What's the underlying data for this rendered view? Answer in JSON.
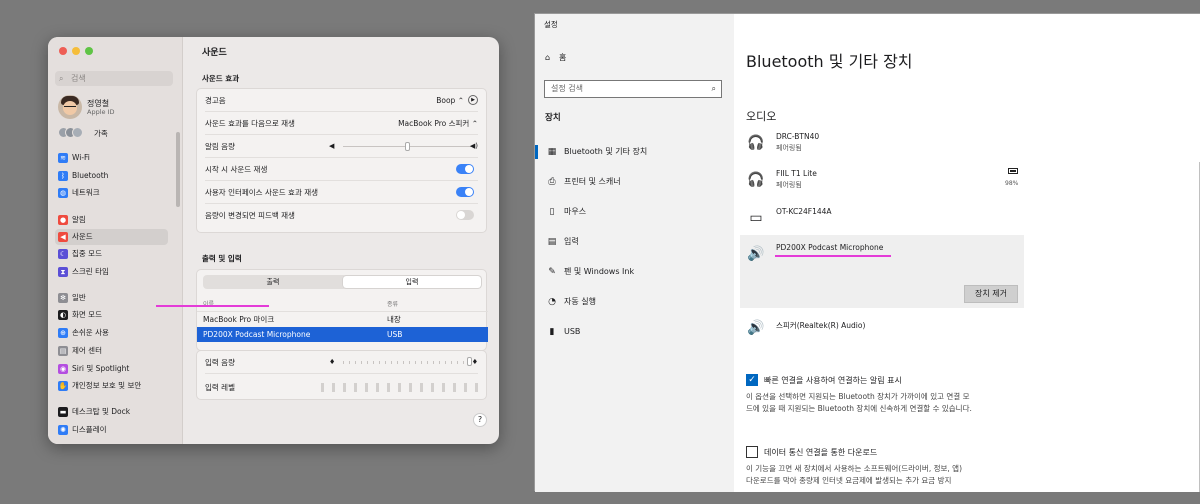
{
  "mac": {
    "search_placeholder": "검색",
    "user": {
      "name": "정영철",
      "sub": "Apple ID"
    },
    "family": "가족",
    "sidebar": [
      {
        "label": "Wi-Fi",
        "icon": "wifi-icon",
        "color": "#2f7cf6"
      },
      {
        "label": "Bluetooth",
        "icon": "bluetooth-icon",
        "color": "#2f7cf6"
      },
      {
        "label": "네트워크",
        "icon": "globe-icon",
        "color": "#2f7cf6"
      },
      {
        "label": "알림",
        "icon": "bell-icon",
        "color": "#ef4b3f"
      },
      {
        "label": "사운드",
        "icon": "speaker-icon",
        "color": "#ef4b3f"
      },
      {
        "label": "집중 모드",
        "icon": "moon-icon",
        "color": "#5b4fd6"
      },
      {
        "label": "스크린 타임",
        "icon": "hourglass-icon",
        "color": "#5b4fd6"
      },
      {
        "label": "일반",
        "icon": "gear-icon",
        "color": "#8e8e93"
      },
      {
        "label": "화면 모드",
        "icon": "appearance-icon",
        "color": "#1c1c1e"
      },
      {
        "label": "손쉬운 사용",
        "icon": "accessibility-icon",
        "color": "#2f7cf6"
      },
      {
        "label": "제어 센터",
        "icon": "control-center-icon",
        "color": "#8e8e93"
      },
      {
        "label": "Siri 및 Spotlight",
        "icon": "siri-icon",
        "color": "#b44ee0"
      },
      {
        "label": "개인정보 보호 및 보안",
        "icon": "hand-icon",
        "color": "#2f7cf6"
      },
      {
        "label": "데스크탑 및 Dock",
        "icon": "dock-icon",
        "color": "#1c1c1e"
      },
      {
        "label": "디스플레이",
        "icon": "display-icon",
        "color": "#2f7cf6"
      }
    ],
    "title": "사운드",
    "effects": {
      "header": "사운드 효과",
      "alert_label": "경고음",
      "alert_value": "Boop",
      "play_label": "사운드 효과를 다음으로 재생",
      "play_value": "MacBook Pro 스피커",
      "volume_label": "알림 음량",
      "startup_label": "시작 시 사운드 재생",
      "ui_label": "사용자 인터페이스 사운드 효과 재생",
      "feedback_label": "음량이 변경되면 피드백 재생"
    },
    "io": {
      "header": "출력 및 입력",
      "tab_output": "출력",
      "tab_input": "입력",
      "col_name": "이름",
      "col_type": "종류",
      "rows": [
        {
          "name": "MacBook Pro 마이크",
          "type": "내장"
        },
        {
          "name": "PD200X Podcast Microphone",
          "type": "USB"
        }
      ],
      "input_volume": "입력 음량",
      "input_level": "입력 레벨"
    },
    "help": "?"
  },
  "win": {
    "window_title": "설정",
    "controls": [
      "—",
      "☐",
      "✕"
    ],
    "home": "홈",
    "search_placeholder": "설정 검색",
    "section": "장치",
    "nav": [
      {
        "label": "Bluetooth 및 기타 장치",
        "icon": "bluetooth-devices-icon"
      },
      {
        "label": "프린터 및 스캐너",
        "icon": "printer-icon"
      },
      {
        "label": "마우스",
        "icon": "mouse-icon"
      },
      {
        "label": "입력",
        "icon": "keyboard-icon"
      },
      {
        "label": "펜 및 Windows Ink",
        "icon": "pen-icon"
      },
      {
        "label": "자동 실행",
        "icon": "autoplay-icon"
      },
      {
        "label": "USB",
        "icon": "usb-icon"
      }
    ],
    "page_title": "Bluetooth 및 기타 장치",
    "audio_header": "오디오",
    "devices": [
      {
        "name": "DRC-BTN40",
        "status": "페어링됨",
        "icon": "headset-icon"
      },
      {
        "name": "FIIL T1 Lite",
        "status": "페어링됨",
        "icon": "headset-icon",
        "battery": "98%"
      },
      {
        "name": "OT-KC24F144A",
        "status": "",
        "icon": "monitor-icon"
      },
      {
        "name": "PD200X Podcast Microphone",
        "status": "",
        "icon": "speaker-icon"
      },
      {
        "name": "스피커(Realtek(R) Audio)",
        "status": "",
        "icon": "speaker-icon"
      }
    ],
    "remove_button": "장치 제거",
    "swift_pair": {
      "label": "빠른 연결을 사용하여 연결하는 알림 표시",
      "desc1": "이 옵션을 선택하면 지원되는 Bluetooth 장치가 가까이에 있고 연결 모",
      "desc2": "드에 있을 때 지원되는 Bluetooth 장치에 신속하게 연결할 수 있습니다."
    },
    "metered": {
      "label": "데이터 통신 연결을 통한 다운로드",
      "desc1": "이 기능을 끄면 새 장치에서 사용하는 소프트웨어(드라이버, 정보, 앱)",
      "desc2": "다운로드를 막아 종량제 인터넷 요금제에 발생되는 추가 요금 방지"
    }
  }
}
